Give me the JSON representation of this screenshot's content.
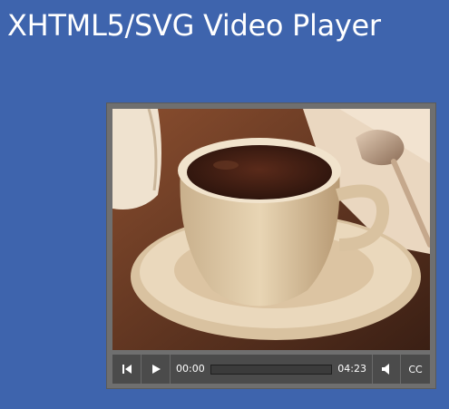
{
  "page": {
    "title": "XHTML5/SVG Video Player"
  },
  "player": {
    "video": {
      "frame_description_icon": "video-frame"
    },
    "controls": {
      "rewind_icon": "skip-back-icon",
      "play_icon": "play-icon",
      "current_time": "00:00",
      "duration": "04:23",
      "progress": 0,
      "volume_icon": "speaker-icon",
      "captions_label": "CC"
    }
  },
  "colors": {
    "background": "#3e64ad",
    "player_frame": "#6f6f6f",
    "controls_bar": "#4b4b4b",
    "text": "#ffffff"
  }
}
